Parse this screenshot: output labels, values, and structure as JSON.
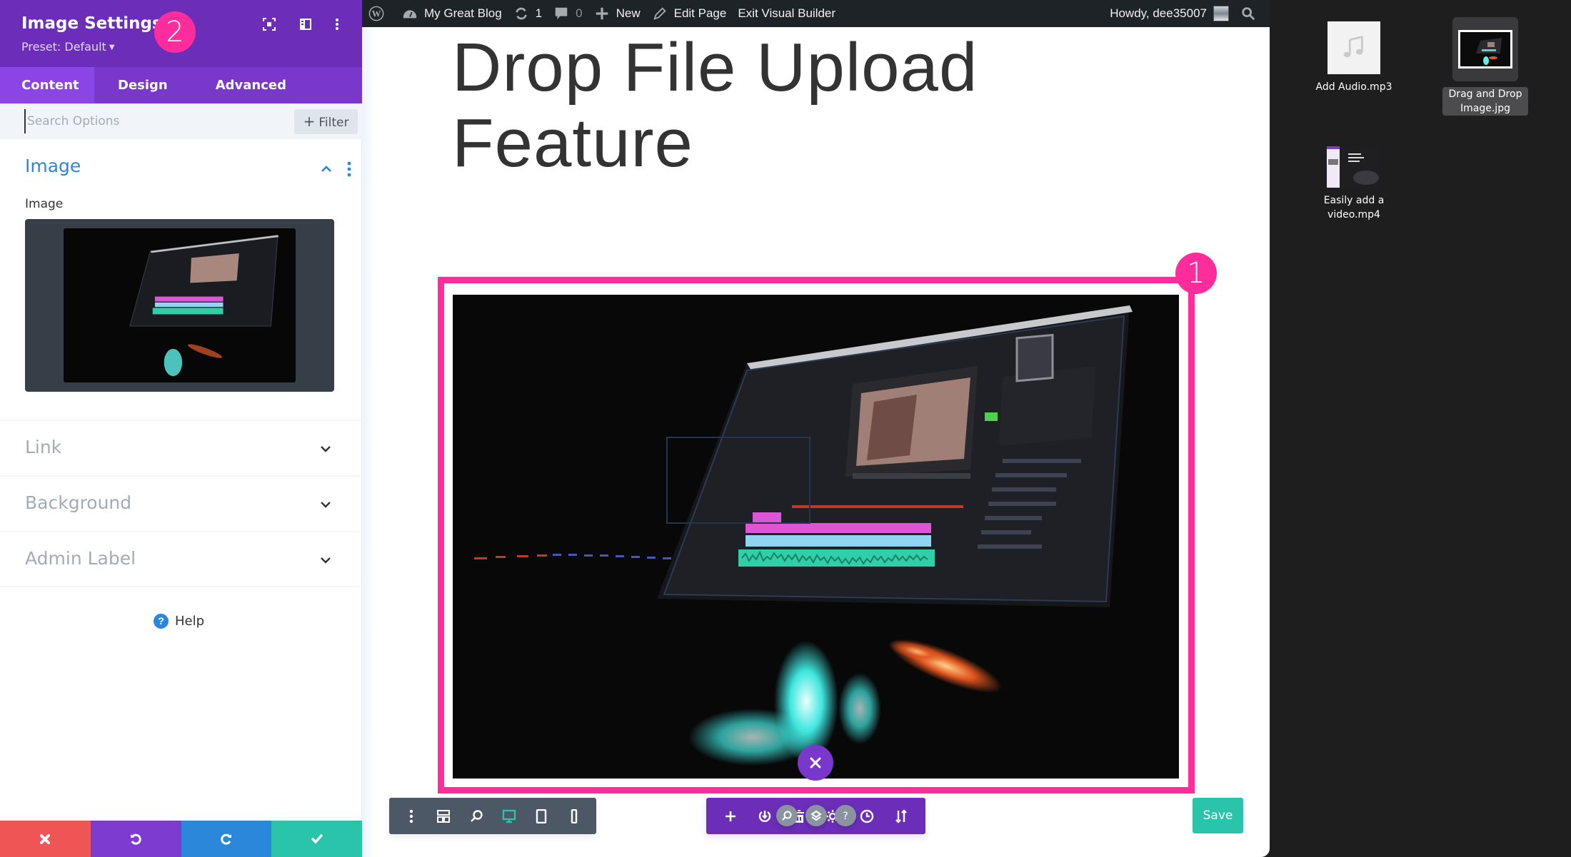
{
  "sidebar": {
    "title": "Image Settings",
    "preset": "Preset: Default",
    "annotation_badge": "2",
    "header_icons": [
      "focus-mode-icon",
      "split-view-icon",
      "more-vertical-icon"
    ],
    "tabs": [
      {
        "label": "Content",
        "active": true
      },
      {
        "label": "Design",
        "active": false
      },
      {
        "label": "Advanced",
        "active": false
      }
    ],
    "search": {
      "placeholder": "Search Options",
      "value": ""
    },
    "filter_label": "Filter",
    "open_section": {
      "title": "Image",
      "field_label": "Image",
      "preview_alt": "Video editing software on laptop"
    },
    "sections": [
      {
        "label": "Link"
      },
      {
        "label": "Background"
      },
      {
        "label": "Admin Label"
      }
    ],
    "help_label": "Help",
    "footer_buttons": [
      {
        "name": "discard",
        "icon": "close-icon",
        "color": "#ef5555"
      },
      {
        "name": "undo",
        "icon": "undo-icon",
        "color": "#7e3bd0"
      },
      {
        "name": "redo",
        "icon": "redo-icon",
        "color": "#2b87da"
      },
      {
        "name": "confirm",
        "icon": "check-icon",
        "color": "#29c4a9"
      }
    ]
  },
  "adminbar": {
    "site_name": "My Great Blog",
    "updates_count": "1",
    "comments_count": "0",
    "new_label": "New",
    "edit_label": "Edit Page",
    "exit_label": "Exit Visual Builder",
    "howdy": "Howdy, dee35007"
  },
  "canvas": {
    "page_title": "Drop File Upload Feature",
    "annotation_badge": "1",
    "save_label": "Save",
    "view_bar_icons": [
      "more-vertical-icon",
      "wireframe-icon",
      "zoom-icon",
      "desktop-view-icon",
      "tablet-view-icon",
      "phone-view-icon"
    ],
    "active_view": "desktop",
    "module_bar_icons": [
      "add-icon",
      "portability-icon",
      "trash-icon",
      "settings-icon",
      "history-icon",
      "page-settings-icon"
    ]
  },
  "desktop": {
    "files": [
      {
        "name": "Add Audio.mp3",
        "type": "audio",
        "selected": false
      },
      {
        "name": "Drag and Drop Image.jpg",
        "type": "image",
        "selected": true
      },
      {
        "name": "Easily add a video.mp4",
        "type": "video",
        "selected": false
      }
    ]
  },
  "colors": {
    "divi_purple": "#6c2eb9",
    "tab_purple": "#7a37cc",
    "annotation_pink": "#ff2d9b",
    "accent_blue": "#2b87da",
    "save_green": "#29c4a9",
    "admin_bar": "#1d2327"
  }
}
